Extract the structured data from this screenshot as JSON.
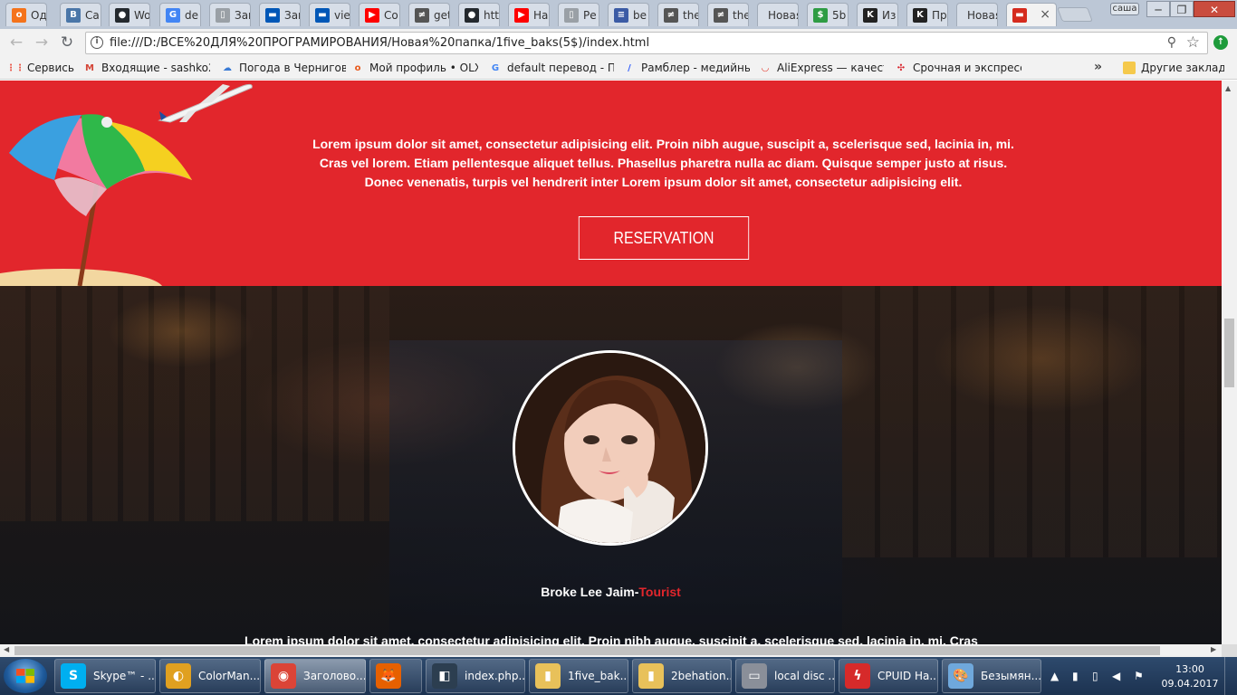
{
  "browser": {
    "tabs": [
      {
        "label": "Од",
        "icon": "odnoklassniki-icon",
        "color": "#f4731c",
        "glyph": "о"
      },
      {
        "label": "Са",
        "icon": "vk-icon",
        "color": "#4a76a8",
        "glyph": "В"
      },
      {
        "label": "Wo",
        "icon": "github-icon",
        "color": "#24292e",
        "glyph": "●"
      },
      {
        "label": "de",
        "icon": "google-icon",
        "color": "#4285f4",
        "glyph": "G"
      },
      {
        "label": "Заг",
        "icon": "page-icon",
        "color": "#9aa0a6",
        "glyph": "▯"
      },
      {
        "label": "Заг",
        "icon": "ukraine-flag-icon",
        "color": "#0057b7",
        "glyph": "▬"
      },
      {
        "label": "vie",
        "icon": "ukraine-flag-icon",
        "color": "#0057b7",
        "glyph": "▬"
      },
      {
        "label": "Co",
        "icon": "youtube-icon",
        "color": "#ff0000",
        "glyph": "▶"
      },
      {
        "label": "get",
        "icon": "weblink-icon",
        "color": "#555555",
        "glyph": "≠"
      },
      {
        "label": "htt",
        "icon": "github-icon",
        "color": "#24292e",
        "glyph": "●"
      },
      {
        "label": "На",
        "icon": "youtube-icon",
        "color": "#ff0000",
        "glyph": "▶"
      },
      {
        "label": "Ре",
        "icon": "page-icon",
        "color": "#9aa0a6",
        "glyph": "▯"
      },
      {
        "label": "be",
        "icon": "chart-icon",
        "color": "#3b5ba5",
        "glyph": "≡"
      },
      {
        "label": "the",
        "icon": "weblink-icon",
        "color": "#555555",
        "glyph": "≠"
      },
      {
        "label": "the",
        "icon": "weblink-icon",
        "color": "#555555",
        "glyph": "≠"
      },
      {
        "label": "Новая",
        "icon": "none",
        "color": "transparent",
        "glyph": ""
      },
      {
        "label": "5b",
        "icon": "money-icon",
        "color": "#2e9c44",
        "glyph": "$"
      },
      {
        "label": "Из",
        "icon": "k-icon",
        "color": "#222222",
        "glyph": "K"
      },
      {
        "label": "Пр",
        "icon": "k-icon",
        "color": "#222222",
        "glyph": "K"
      },
      {
        "label": "Новая",
        "icon": "none",
        "color": "transparent",
        "glyph": ""
      },
      {
        "label": "",
        "icon": "flag-icon",
        "color": "#d52b1e",
        "glyph": "▬"
      }
    ],
    "close_tab_glyph": "×",
    "profile_name": "саша",
    "window": {
      "minimize": "─",
      "restore": "❐",
      "close": "✕"
    },
    "nav": {
      "back": "←",
      "forward": "→",
      "reload": "↻"
    },
    "url": "file:///D:/ВСЕ%20ДЛЯ%20ПРОГРАМИРОВАНИЯ/Новая%20папка/1five_baks(5$)/index.html",
    "info_glyph": "i",
    "zoom_glyph": "⚲",
    "star_glyph": "☆",
    "update_glyph": "↑",
    "bookmarks": [
      {
        "label": "Сервисы",
        "icon": "apps-icon",
        "color": "#e84d3d",
        "glyph": "⋮⋮"
      },
      {
        "label": "Входящие - sashko23",
        "icon": "gmail-icon",
        "color": "#d44638",
        "glyph": "M"
      },
      {
        "label": "Погода в Чернигове",
        "icon": "weather-icon",
        "color": "#3a7bd5",
        "glyph": "☁"
      },
      {
        "label": "Мой профиль • OLX.u",
        "icon": "olx-icon",
        "color": "#e85a1c",
        "glyph": "o"
      },
      {
        "label": "default перевод - По",
        "icon": "google-icon",
        "color": "#4285f4",
        "glyph": "G"
      },
      {
        "label": "Рамблер - медийный",
        "icon": "rambler-icon",
        "color": "#315efb",
        "glyph": "/"
      },
      {
        "label": "AliExpress — качеств",
        "icon": "aliexpress-icon",
        "color": "#e43225",
        "glyph": "◡"
      },
      {
        "label": "Срочная и экспресс д",
        "icon": "delivery-icon",
        "color": "#d8232a",
        "glyph": "✣"
      },
      {
        "label": "Другие закладки",
        "icon": "folder-icon",
        "color": "#f5c94c",
        "glyph": ""
      }
    ],
    "more_bookmarks": "»"
  },
  "page": {
    "red_text": "Lorem ipsum dolor sit amet, consectetur adipisicing elit. Proin nibh augue, suscipit a, scelerisque sed, lacinia in, mi. Cras vel lorem. Etiam pellentesque aliquet tellus. Phasellus pharetra nulla ac diam. Quisque semper justo at risus. Donec venenatis, turpis vel hendrerit inter Lorem ipsum dolor sit amet, consectetur adipisicing elit.",
    "reservation_label": "RESERVATION",
    "person_name": "Broke Lee Jaim-",
    "person_role": "Tourist",
    "night_text": "Lorem ipsum dolor sit amet, consectetur adipisicing elit. Proin nibh augue, suscipit a, scelerisque sed, lacinia in, mi. Cras vel"
  },
  "taskbar": {
    "items": [
      {
        "label": "Skype™ - ...",
        "icon": "skype-icon",
        "color": "#00aff0",
        "glyph": "S"
      },
      {
        "label": "ColorMan...",
        "icon": "colormania-icon",
        "color": "#e0a020",
        "glyph": "◐"
      },
      {
        "label": "Заголово...",
        "icon": "chrome-icon",
        "color": "#db4437",
        "glyph": "◉"
      },
      {
        "label": "",
        "icon": "firefox-icon",
        "color": "#e66000",
        "glyph": "🦊"
      },
      {
        "label": "index.php...",
        "icon": "editor-icon",
        "color": "#2c3e50",
        "glyph": "◧"
      },
      {
        "label": "1five_bak...",
        "icon": "folder-icon",
        "color": "#e8c15a",
        "glyph": "▮"
      },
      {
        "label": "2behation...",
        "icon": "folder-icon",
        "color": "#e8c15a",
        "glyph": "▮"
      },
      {
        "label": "local disc ...",
        "icon": "drive-icon",
        "color": "#8a8f99",
        "glyph": "▭"
      },
      {
        "label": "CPUID Ha...",
        "icon": "cpuid-icon",
        "color": "#d62a2a",
        "glyph": "ϟ"
      },
      {
        "label": "Безымян...",
        "icon": "paint-icon",
        "color": "#6fa8dc",
        "glyph": "🎨"
      }
    ],
    "tray": {
      "expand": "▲",
      "signal": "▮",
      "battery": "▯",
      "volume": "◀",
      "flag": "⚑"
    },
    "time": "13:00",
    "date": "09.04.2017"
  }
}
